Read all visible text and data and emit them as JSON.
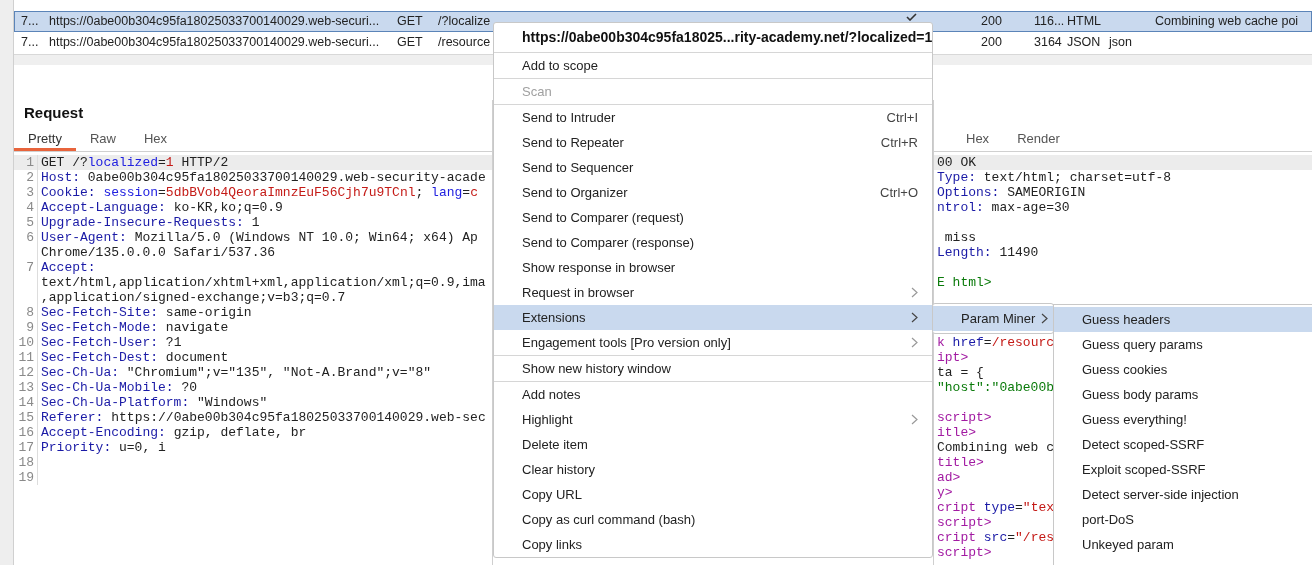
{
  "history_table": {
    "rows": [
      {
        "selected": true,
        "num": "7...",
        "url": "https://0abe00b304c95fa18025033700140029.web-securi...",
        "method": "GET",
        "path": "/?localize",
        "params": true,
        "status": "200",
        "length": "116...",
        "mime": "HTML",
        "title": "Combining web cache poi"
      },
      {
        "selected": false,
        "num": "7...",
        "url": "https://0abe00b304c95fa18025033700140029.web-securi...",
        "method": "GET",
        "path": "/resource",
        "params": false,
        "status": "200",
        "length": "3164",
        "mime": "JSON",
        "ext": "json"
      }
    ]
  },
  "request": {
    "title": "Request",
    "tabs": [
      {
        "label": "Pretty",
        "selected": true
      },
      {
        "label": "Raw",
        "selected": false
      },
      {
        "label": "Hex",
        "selected": false
      }
    ],
    "lines": [
      {
        "number": "1",
        "segments": [
          {
            "text": "GET /?",
            "kind": "plain"
          },
          {
            "text": "localized",
            "kind": "param"
          },
          {
            "text": "=",
            "kind": "plain"
          },
          {
            "text": "1",
            "kind": "num"
          },
          {
            "text": " HTTP/2",
            "kind": "plain"
          }
        ]
      },
      {
        "number": "2",
        "segments": [
          {
            "text": "Host:",
            "kind": "key"
          },
          {
            "text": " 0abe00b304c95fa18025033700140029.web-security-acade",
            "kind": "plain"
          }
        ]
      },
      {
        "number": "3",
        "segments": [
          {
            "text": "Cookie:",
            "kind": "key"
          },
          {
            "text": " session",
            "kind": "param"
          },
          {
            "text": "=",
            "kind": "plain"
          },
          {
            "text": "5dbBVob4QeoraImnzEuF56Cjh7u9TCnl",
            "kind": "num"
          },
          {
            "text": "; ",
            "kind": "plain"
          },
          {
            "text": "lang",
            "kind": "param"
          },
          {
            "text": "=",
            "kind": "plain"
          },
          {
            "text": "c",
            "kind": "num"
          }
        ]
      },
      {
        "number": "4",
        "segments": [
          {
            "text": "Accept-Language:",
            "kind": "key"
          },
          {
            "text": " ko-KR,ko;q=0.9",
            "kind": "plain"
          }
        ]
      },
      {
        "number": "5",
        "segments": [
          {
            "text": "Upgrade-Insecure-Requests:",
            "kind": "key"
          },
          {
            "text": " 1",
            "kind": "plain"
          }
        ]
      },
      {
        "number": "6",
        "segments": [
          {
            "text": "User-Agent:",
            "kind": "key"
          },
          {
            "text": " Mozilla/5.0 (Windows NT 10.0; Win64; x64) Ap",
            "kind": "plain"
          }
        ]
      },
      {
        "segments": [
          {
            "text": "Chrome/135.0.0.0 Safari/537.36",
            "kind": "plain"
          }
        ]
      },
      {
        "number": "7",
        "segments": [
          {
            "text": "Accept:",
            "kind": "key"
          }
        ]
      },
      {
        "segments": [
          {
            "text": "text/html,application/xhtml+xml,application/xml;q=0.9,ima",
            "kind": "plain"
          }
        ]
      },
      {
        "segments": [
          {
            "text": ",application/signed-exchange;v=b3;q=0.7",
            "kind": "plain"
          }
        ]
      },
      {
        "number": "8",
        "segments": [
          {
            "text": "Sec-Fetch-Site:",
            "kind": "key"
          },
          {
            "text": " same-origin",
            "kind": "plain"
          }
        ]
      },
      {
        "number": "9",
        "segments": [
          {
            "text": "Sec-Fetch-Mode:",
            "kind": "key"
          },
          {
            "text": " navigate",
            "kind": "plain"
          }
        ]
      },
      {
        "number": "10",
        "segments": [
          {
            "text": "Sec-Fetch-User:",
            "kind": "key"
          },
          {
            "text": " ?1",
            "kind": "plain"
          }
        ]
      },
      {
        "number": "11",
        "segments": [
          {
            "text": "Sec-Fetch-Dest:",
            "kind": "key"
          },
          {
            "text": " document",
            "kind": "plain"
          }
        ]
      },
      {
        "number": "12",
        "segments": [
          {
            "text": "Sec-Ch-Ua:",
            "kind": "key"
          },
          {
            "text": " \"Chromium\";v=\"135\", \"Not-A.Brand\";v=\"8\"",
            "kind": "plain"
          }
        ]
      },
      {
        "number": "13",
        "segments": [
          {
            "text": "Sec-Ch-Ua-Mobile:",
            "kind": "key"
          },
          {
            "text": " ?0",
            "kind": "plain"
          }
        ]
      },
      {
        "number": "14",
        "segments": [
          {
            "text": "Sec-Ch-Ua-Platform:",
            "kind": "key"
          },
          {
            "text": " \"Windows\"",
            "kind": "plain"
          }
        ]
      },
      {
        "number": "15",
        "segments": [
          {
            "text": "Referer:",
            "kind": "key"
          },
          {
            "text": " https://0abe00b304c95fa18025033700140029.web-sec",
            "kind": "plain"
          }
        ]
      },
      {
        "number": "16",
        "segments": [
          {
            "text": "Accept-Encoding:",
            "kind": "key"
          },
          {
            "text": " gzip, deflate, br",
            "kind": "plain"
          }
        ]
      },
      {
        "number": "17",
        "segments": [
          {
            "text": "Priority:",
            "kind": "key"
          },
          {
            "text": " u=0, i",
            "kind": "plain"
          }
        ]
      },
      {
        "number": "18"
      },
      {
        "number": "19"
      }
    ]
  },
  "response": {
    "tabs": [
      {
        "label": "Hex",
        "selected": false
      },
      {
        "label": "Render",
        "selected": false
      }
    ],
    "lines": [
      {
        "kind": "code",
        "segments": [
          {
            "text": "00 OK",
            "kind": "plain"
          }
        ]
      },
      {
        "kind": "code",
        "segments": [
          {
            "text": "Type:",
            "kind": "key"
          },
          {
            "text": " text/html; charset=utf-8",
            "kind": "plain"
          }
        ]
      },
      {
        "kind": "code",
        "segments": [
          {
            "text": "Options:",
            "kind": "key"
          },
          {
            "text": " SAMEORIGIN",
            "kind": "plain"
          }
        ]
      },
      {
        "kind": "code",
        "segments": [
          {
            "text": "ntrol:",
            "kind": "key"
          },
          {
            "text": " max-age=30",
            "kind": "plain"
          }
        ]
      },
      {
        "kind": "blank"
      },
      {
        "kind": "code",
        "segments": [
          {
            "text": " miss",
            "kind": "plain"
          }
        ]
      },
      {
        "kind": "code",
        "segments": [
          {
            "text": "Length:",
            "kind": "key"
          },
          {
            "text": " 11490",
            "kind": "plain"
          }
        ]
      },
      {
        "kind": "blank"
      },
      {
        "kind": "code",
        "segments": [
          {
            "text": "E html>",
            "kind": "green"
          }
        ]
      },
      {
        "kind": "blank"
      },
      {
        "kind": "blank"
      },
      {
        "kind": "blank"
      },
      {
        "kind": "code",
        "segments": [
          {
            "text": "k ",
            "kind": "tag"
          },
          {
            "text": "href",
            "kind": "key"
          },
          {
            "text": "=",
            "kind": "plain"
          },
          {
            "text": "/resourc",
            "kind": "num"
          }
        ]
      },
      {
        "kind": "code",
        "segments": [
          {
            "text": "ipt>",
            "kind": "tag"
          }
        ]
      },
      {
        "kind": "code",
        "segments": [
          {
            "text": "ta = {",
            "kind": "plain"
          }
        ]
      },
      {
        "kind": "code",
        "segments": [
          {
            "text": "\"host\":\"0abe00b",
            "kind": "green"
          }
        ]
      },
      {
        "kind": "blank"
      },
      {
        "kind": "code",
        "segments": [
          {
            "text": "script>",
            "kind": "tag"
          }
        ]
      },
      {
        "kind": "code",
        "segments": [
          {
            "text": "itle>",
            "kind": "tag"
          }
        ]
      },
      {
        "kind": "code",
        "segments": [
          {
            "text": "Combining web c",
            "kind": "plain"
          }
        ]
      },
      {
        "kind": "code",
        "segments": [
          {
            "text": "title>",
            "kind": "tag"
          }
        ]
      },
      {
        "kind": "code",
        "segments": [
          {
            "text": "ad>",
            "kind": "tag"
          }
        ]
      },
      {
        "kind": "code",
        "segments": [
          {
            "text": "y>",
            "kind": "tag"
          }
        ]
      },
      {
        "kind": "code",
        "segments": [
          {
            "text": "cript ",
            "kind": "tag"
          },
          {
            "text": "type",
            "kind": "key"
          },
          {
            "text": "=",
            "kind": "plain"
          },
          {
            "text": "\"tex",
            "kind": "num"
          }
        ]
      },
      {
        "kind": "code",
        "segments": [
          {
            "text": "script>",
            "kind": "tag"
          }
        ]
      },
      {
        "kind": "code",
        "segments": [
          {
            "text": "cript ",
            "kind": "tag"
          },
          {
            "text": "src",
            "kind": "key"
          },
          {
            "text": "=",
            "kind": "plain"
          },
          {
            "text": "\"/res",
            "kind": "num"
          }
        ]
      },
      {
        "kind": "code",
        "segments": [
          {
            "text": "script>",
            "kind": "tag"
          }
        ]
      }
    ]
  },
  "context_menu": {
    "title": "https://0abe00b304c95fa18025...rity-academy.net/?localized=1",
    "groups": [
      [
        {
          "label": "Add to scope",
          "selected": false,
          "disabled": false,
          "has_submenu": false
        }
      ],
      [
        {
          "label": "Scan",
          "selected": false,
          "disabled": true,
          "has_submenu": false
        }
      ],
      [
        {
          "label": "Send to Intruder",
          "shortcut": "Ctrl+I",
          "selected": false,
          "disabled": false,
          "has_submenu": false
        },
        {
          "label": "Send to Repeater",
          "shortcut": "Ctrl+R",
          "selected": false,
          "disabled": false,
          "has_submenu": false
        },
        {
          "label": "Send to Sequencer",
          "selected": false,
          "disabled": false,
          "has_submenu": false
        },
        {
          "label": "Send to Organizer",
          "shortcut": "Ctrl+O",
          "selected": false,
          "disabled": false,
          "has_submenu": false
        },
        {
          "label": "Send to Comparer (request)",
          "selected": false,
          "disabled": false,
          "has_submenu": false
        },
        {
          "label": "Send to Comparer (response)",
          "selected": false,
          "disabled": false,
          "has_submenu": false
        },
        {
          "label": "Show response in browser",
          "selected": false,
          "disabled": false,
          "has_submenu": false
        },
        {
          "label": "Request in browser",
          "selected": false,
          "disabled": false,
          "has_submenu": true
        },
        {
          "label": "Extensions",
          "selected": true,
          "disabled": false,
          "has_submenu": true
        },
        {
          "label": "Engagement tools [Pro version only]",
          "selected": false,
          "disabled": false,
          "has_submenu": true
        }
      ],
      [
        {
          "label": "Show new history window",
          "selected": false,
          "disabled": false,
          "has_submenu": false
        }
      ],
      [
        {
          "label": "Add notes",
          "selected": false,
          "disabled": false,
          "has_submenu": false
        },
        {
          "label": "Highlight",
          "selected": false,
          "disabled": false,
          "has_submenu": true
        },
        {
          "label": "Delete item",
          "selected": false,
          "disabled": false,
          "has_submenu": false
        },
        {
          "label": "Clear history",
          "selected": false,
          "disabled": false,
          "has_submenu": false
        },
        {
          "label": "Copy URL",
          "selected": false,
          "disabled": false,
          "has_submenu": false
        },
        {
          "label": "Copy as curl command (bash)",
          "selected": false,
          "disabled": false,
          "has_submenu": false
        },
        {
          "label": "Copy links",
          "selected": false,
          "disabled": false,
          "has_submenu": false
        }
      ]
    ]
  },
  "extensions_submenu": {
    "items": [
      {
        "label": "Param Miner",
        "selected": true,
        "has_submenu": true
      }
    ]
  },
  "param_miner_submenu": {
    "items": [
      {
        "label": "Guess headers",
        "selected": true
      },
      {
        "label": "Guess query params",
        "selected": false
      },
      {
        "label": "Guess cookies",
        "selected": false
      },
      {
        "label": "Guess body params",
        "selected": false
      },
      {
        "label": "Guess everything!",
        "selected": false
      },
      {
        "label": "Detect scoped-SSRF",
        "selected": false
      },
      {
        "label": "Exploit scoped-SSRF",
        "selected": false
      },
      {
        "label": "Detect server-side injection",
        "selected": false
      },
      {
        "label": "port-DoS",
        "selected": false
      },
      {
        "label": "Unkeyed param",
        "selected": false
      }
    ]
  }
}
